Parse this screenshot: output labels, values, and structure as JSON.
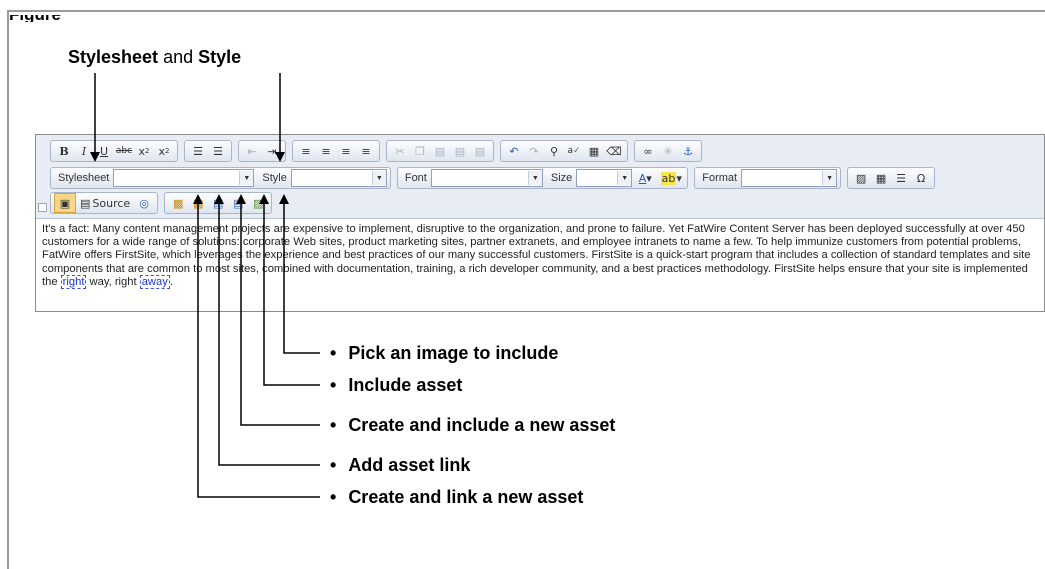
{
  "figure": {
    "label": "Figure"
  },
  "top_callout": {
    "stylesheet_word": "Stylesheet",
    "and_word": "and",
    "style_word": "Style"
  },
  "toolbar": {
    "stylesheet_label": "Stylesheet",
    "style_label": "Style",
    "font_label": "Font",
    "size_label": "Size",
    "format_label": "Format",
    "source_label": "Source"
  },
  "content": {
    "text": "It's a fact: Many content management projects are expensive to implement, disruptive to the organization, and prone to failure. Yet FatWire Content Server has been deployed successfully at over 450 customers for a wide range of solutions: corporate Web sites, product marketing sites, partner extranets, and employee intranets to name a few. To help immunize customers from potential problems, FatWire offers FirstSite, which leverages the experience and best practices of our many successful customers. FirstSite is a quick-start program that includes a collection of standard templates and site components that are common to most sites, combined with documentation, training, a rich developer community, and a best practices methodology. FirstSite helps ensure that your site is implemented the",
    "link1": "right",
    "middle": " way, right ",
    "link2": "away",
    "end": "."
  },
  "callouts": [
    {
      "bullet": "•",
      "text": "Pick an image to include"
    },
    {
      "bullet": "•",
      "text": "Include asset"
    },
    {
      "bullet": "•",
      "text": "Create and include a new asset"
    },
    {
      "bullet": "•",
      "text": "Add asset link"
    },
    {
      "bullet": "•",
      "text": "Create and link a new asset"
    }
  ]
}
